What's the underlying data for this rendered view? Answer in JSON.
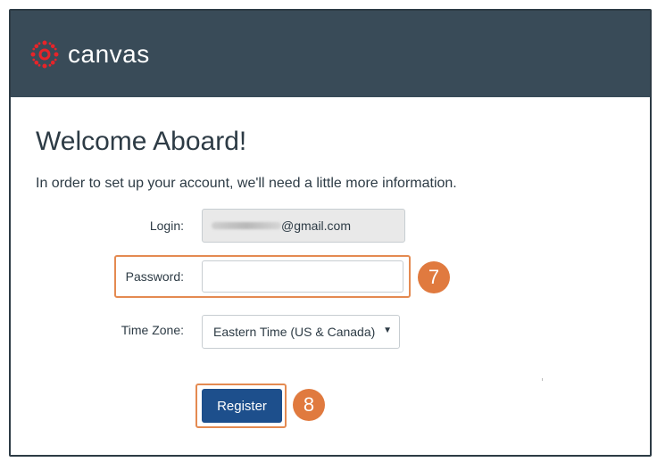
{
  "header": {
    "logo_text": "canvas"
  },
  "main": {
    "title": "Welcome Aboard!",
    "intro": "In order to set up your account, we'll need a little more information."
  },
  "form": {
    "login_label": "Login:",
    "login_value_domain": "@gmail.com",
    "password_label": "Password:",
    "password_value": "",
    "timezone_label": "Time Zone:",
    "timezone_value": "Eastern Time (US & Canada) (-",
    "register_label": "Register"
  },
  "annotations": {
    "step_password": "7",
    "step_register": "8"
  },
  "colors": {
    "header_bg": "#394b58",
    "logo_red": "#e72429",
    "button_blue": "#1d4f8c",
    "annotation_orange": "#e07a3f"
  },
  "icons": {
    "logo": "canvas-logo-icon",
    "dropdown": "dropdown-arrow-icon"
  }
}
